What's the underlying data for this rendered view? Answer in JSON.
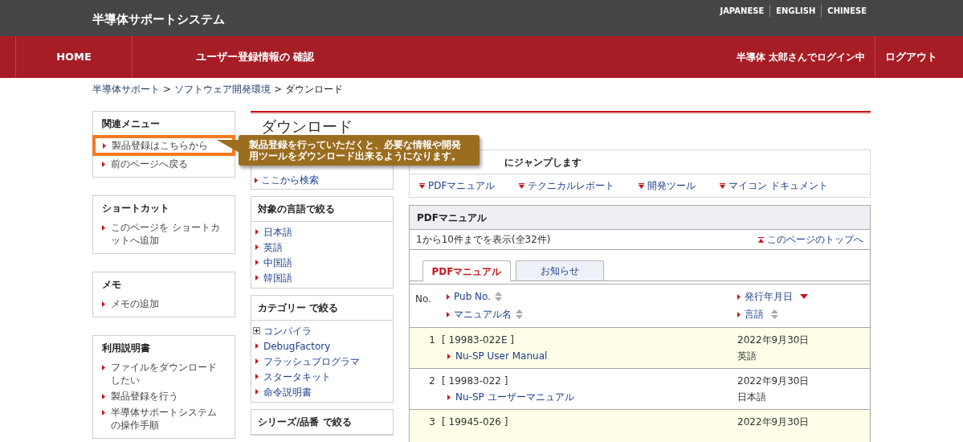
{
  "header": {
    "site_title": "半導体サポートシステム",
    "languages": [
      "JAPANESE",
      "ENGLISH",
      "CHINESE"
    ]
  },
  "nav": {
    "home": "HOME",
    "account": "ユーザー登録情報の 確認",
    "login_status": "半導体 太郎さんでログイン中",
    "logout": "ログアウト"
  },
  "breadcrumb": {
    "items": [
      "半導体サポート",
      "ソフトウェア開発環境",
      "ダウンロード"
    ],
    "separator": ">"
  },
  "left_boxes": [
    {
      "title": "関連メニュー",
      "items": [
        {
          "label": "製品登録はこちらから",
          "highlighted": true
        },
        {
          "label": "前のページへ戻る",
          "highlighted": false
        }
      ]
    },
    {
      "title": "ショートカット",
      "items": [
        {
          "label": "このページを ショートカットへ追加",
          "highlighted": false
        }
      ]
    },
    {
      "title": "メモ",
      "items": [
        {
          "label": "メモの追加",
          "highlighted": false
        }
      ]
    },
    {
      "title": "利用説明書",
      "items": [
        {
          "label": "ファイルをダウンロードしたい",
          "highlighted": false
        },
        {
          "label": "製品登録を行う",
          "highlighted": false
        },
        {
          "label": "半導体サポートシステムの操作手順",
          "highlighted": false
        }
      ]
    }
  ],
  "tooltip": "製品登録を行っていただくと、必要な情報や開発用ツールをダウンロード出来るようになります。",
  "page_title": "ダウンロード",
  "search_link": "ここから検索",
  "filters": [
    {
      "title": "対象の言語で絞る",
      "items": [
        {
          "label": "日本語",
          "kind": "link"
        },
        {
          "label": "英語",
          "kind": "link"
        },
        {
          "label": "中国語",
          "kind": "link"
        },
        {
          "label": "韓国語",
          "kind": "link"
        }
      ]
    },
    {
      "title": "カテゴリー で絞る",
      "items": [
        {
          "label": "コンパイラ",
          "kind": "expand"
        },
        {
          "label": "DebugFactory",
          "kind": "link"
        },
        {
          "label": "フラッシュプログラマ",
          "kind": "link"
        },
        {
          "label": "スタータキット",
          "kind": "link"
        },
        {
          "label": "命令説明書",
          "kind": "link"
        }
      ]
    },
    {
      "title": "シリーズ/品番 で絞る"
    }
  ],
  "jump": {
    "title": "にジャンプします",
    "links": [
      "PDFマニュアル",
      "テクニカルレポート",
      "開発ツール",
      "マイコン ドキュメント"
    ]
  },
  "list": {
    "title": "PDFマニュアル",
    "count": "1から10件までを表示(全32件)",
    "top_link": "このページのトップへ",
    "tabs": [
      {
        "label": "PDFマニュアル",
        "selected": true
      },
      {
        "label": "お知らせ",
        "selected": false
      }
    ],
    "columns": {
      "no": "No.",
      "pub_no": {
        "label": "Pub No.",
        "sorted": false
      },
      "name": {
        "label": "マニュアル名",
        "sorted": false
      },
      "date": {
        "label": "発行年月日",
        "sorted": true
      },
      "language": {
        "label": "言語",
        "sorted": false
      }
    },
    "rows": [
      {
        "no": "1",
        "pub_no": "[ 19983-022E ]",
        "name": "Nu-SP User Manual",
        "date": "2022年9月30日",
        "language": "英語"
      },
      {
        "no": "2",
        "pub_no": "[ 19983-022 ]",
        "name": "Nu-SP ユーザーマニュアル",
        "date": "2022年9月30日",
        "language": "日本語"
      },
      {
        "no": "3",
        "pub_no": "[ 19945-026 ]",
        "date": "2022年9月30日"
      }
    ]
  }
}
